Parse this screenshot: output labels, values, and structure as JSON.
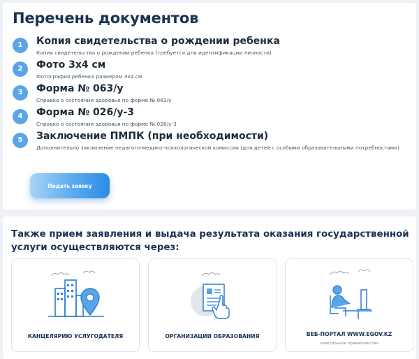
{
  "documents": {
    "title": "Перечень документов",
    "items": [
      {
        "num": "1",
        "title": "Копия свидетельства о рождении ребенка",
        "desc": "Копия свидетельства о рождении ребенка (требуется для идентификации личности)"
      },
      {
        "num": "2",
        "title": "Фото 3х4 см",
        "desc": "Фотография ребенка размером 3х4 см"
      },
      {
        "num": "3",
        "title": "Форма № 063/у",
        "desc": "Справка о состоянии здоровья по форме № 063/у"
      },
      {
        "num": "4",
        "title": "Форма № 026/у-3",
        "desc": "Справка о состоянии здоровья по форме № 026/у-3"
      },
      {
        "num": "5",
        "title": "Заключение ПМПК (при необходимости)",
        "desc": "Дополнительно заключение педагого-медико-психологической комиссии (для детей с особыми образовательными потребностями)"
      }
    ],
    "submit_label": "Подать заявку"
  },
  "channels": {
    "title": "Также прием заявления и выдача результата оказания государственной услуги осуществляются через:",
    "items": [
      {
        "label": "КАНЦЕЛЯРИЮ УСЛУГОДАТЕЛЯ",
        "icon": "office-building-location-icon"
      },
      {
        "label": "ОРГАНИЗАЦИИ ОБРАЗОВАНИЯ",
        "icon": "document-hand-icon"
      },
      {
        "label": "ВЕБ-ПОРТАЛ WWW.EGOV.KZ",
        "sub": "электронное правительство",
        "icon": "person-at-computer-icon"
      }
    ]
  },
  "colors": {
    "accent": "#3a95e8",
    "number_badge": "#5aa4e8",
    "heading": "#1a3352",
    "background": "#eef1f5"
  }
}
